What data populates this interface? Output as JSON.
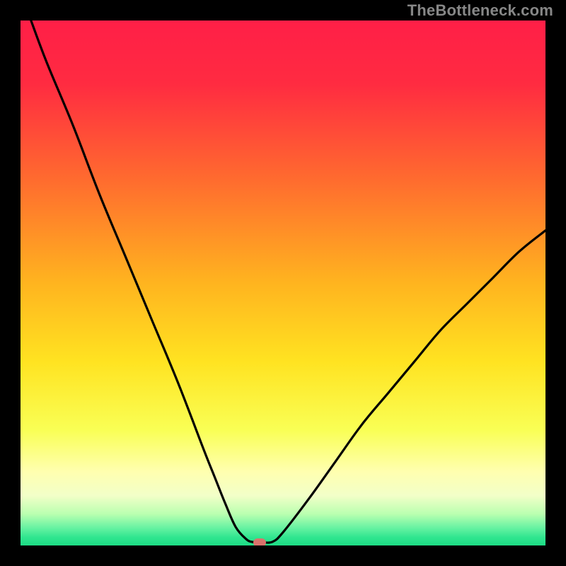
{
  "watermark": "TheBottleneck.com",
  "chart_data": {
    "type": "line",
    "title": "",
    "xlabel": "",
    "ylabel": "",
    "xlim": [
      0,
      100
    ],
    "ylim": [
      0,
      100
    ],
    "grid": false,
    "legend": false,
    "background": "rainbow-gradient red→yellow→green (top→bottom)",
    "series": [
      {
        "name": "bottleneck-curve",
        "color": "#000000",
        "x": [
          2.0,
          5,
          10,
          15,
          20,
          25,
          30,
          35,
          37,
          39,
          41,
          43,
          44,
          45,
          46,
          48,
          50,
          55,
          60,
          65,
          70,
          75,
          80,
          85,
          90,
          95,
          100
        ],
        "y": [
          100,
          92,
          80,
          67,
          55,
          43,
          31,
          18,
          13,
          8,
          3.5,
          1.2,
          0.7,
          0.6,
          0.6,
          0.7,
          2.5,
          9,
          16,
          23,
          29,
          35,
          41,
          46,
          51,
          56,
          60
        ]
      }
    ],
    "marker": {
      "name": "target-point",
      "x": 45.5,
      "y": 0.6,
      "color": "#d9736c"
    },
    "gradient_stops": [
      {
        "offset": 0.0,
        "color": "#ff1f47"
      },
      {
        "offset": 0.12,
        "color": "#ff2b41"
      },
      {
        "offset": 0.3,
        "color": "#ff6a2f"
      },
      {
        "offset": 0.5,
        "color": "#ffb41f"
      },
      {
        "offset": 0.65,
        "color": "#ffe321"
      },
      {
        "offset": 0.78,
        "color": "#f9ff55"
      },
      {
        "offset": 0.86,
        "color": "#ffffb0"
      },
      {
        "offset": 0.905,
        "color": "#f2ffc8"
      },
      {
        "offset": 0.94,
        "color": "#baffb0"
      },
      {
        "offset": 0.965,
        "color": "#6bf3a3"
      },
      {
        "offset": 0.985,
        "color": "#2fe58f"
      },
      {
        "offset": 1.0,
        "color": "#1ddc85"
      }
    ]
  }
}
